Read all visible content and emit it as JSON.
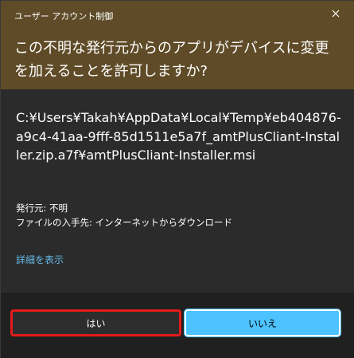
{
  "dialog": {
    "title": "ユーザー アカウント制御",
    "question": "この不明な発行元からのアプリがデバイスに変更を加えることを許可しますか?",
    "file_path": "C:¥Users¥Takah¥AppData¥Local¥Temp¥eb404876-a9c4-41aa-9fff-85d1511e5a7f_amtPlusCliant-Installer.zip.a7f¥amtPlusCliant-Installer.msi",
    "publisher": "発行元: 不明",
    "file_origin": "ファイルの入手先: インターネットからダウンロード",
    "details_link": "詳細を表示",
    "yes_label": "はい",
    "no_label": "いいえ",
    "close_icon": "close-icon"
  },
  "colors": {
    "header_bg": "#5f4b27",
    "body_bg": "#2b2b2b",
    "footer_bg": "#202020",
    "accent": "#4cc2ff",
    "link": "#63b9e6",
    "highlight": "#e31b1b"
  }
}
